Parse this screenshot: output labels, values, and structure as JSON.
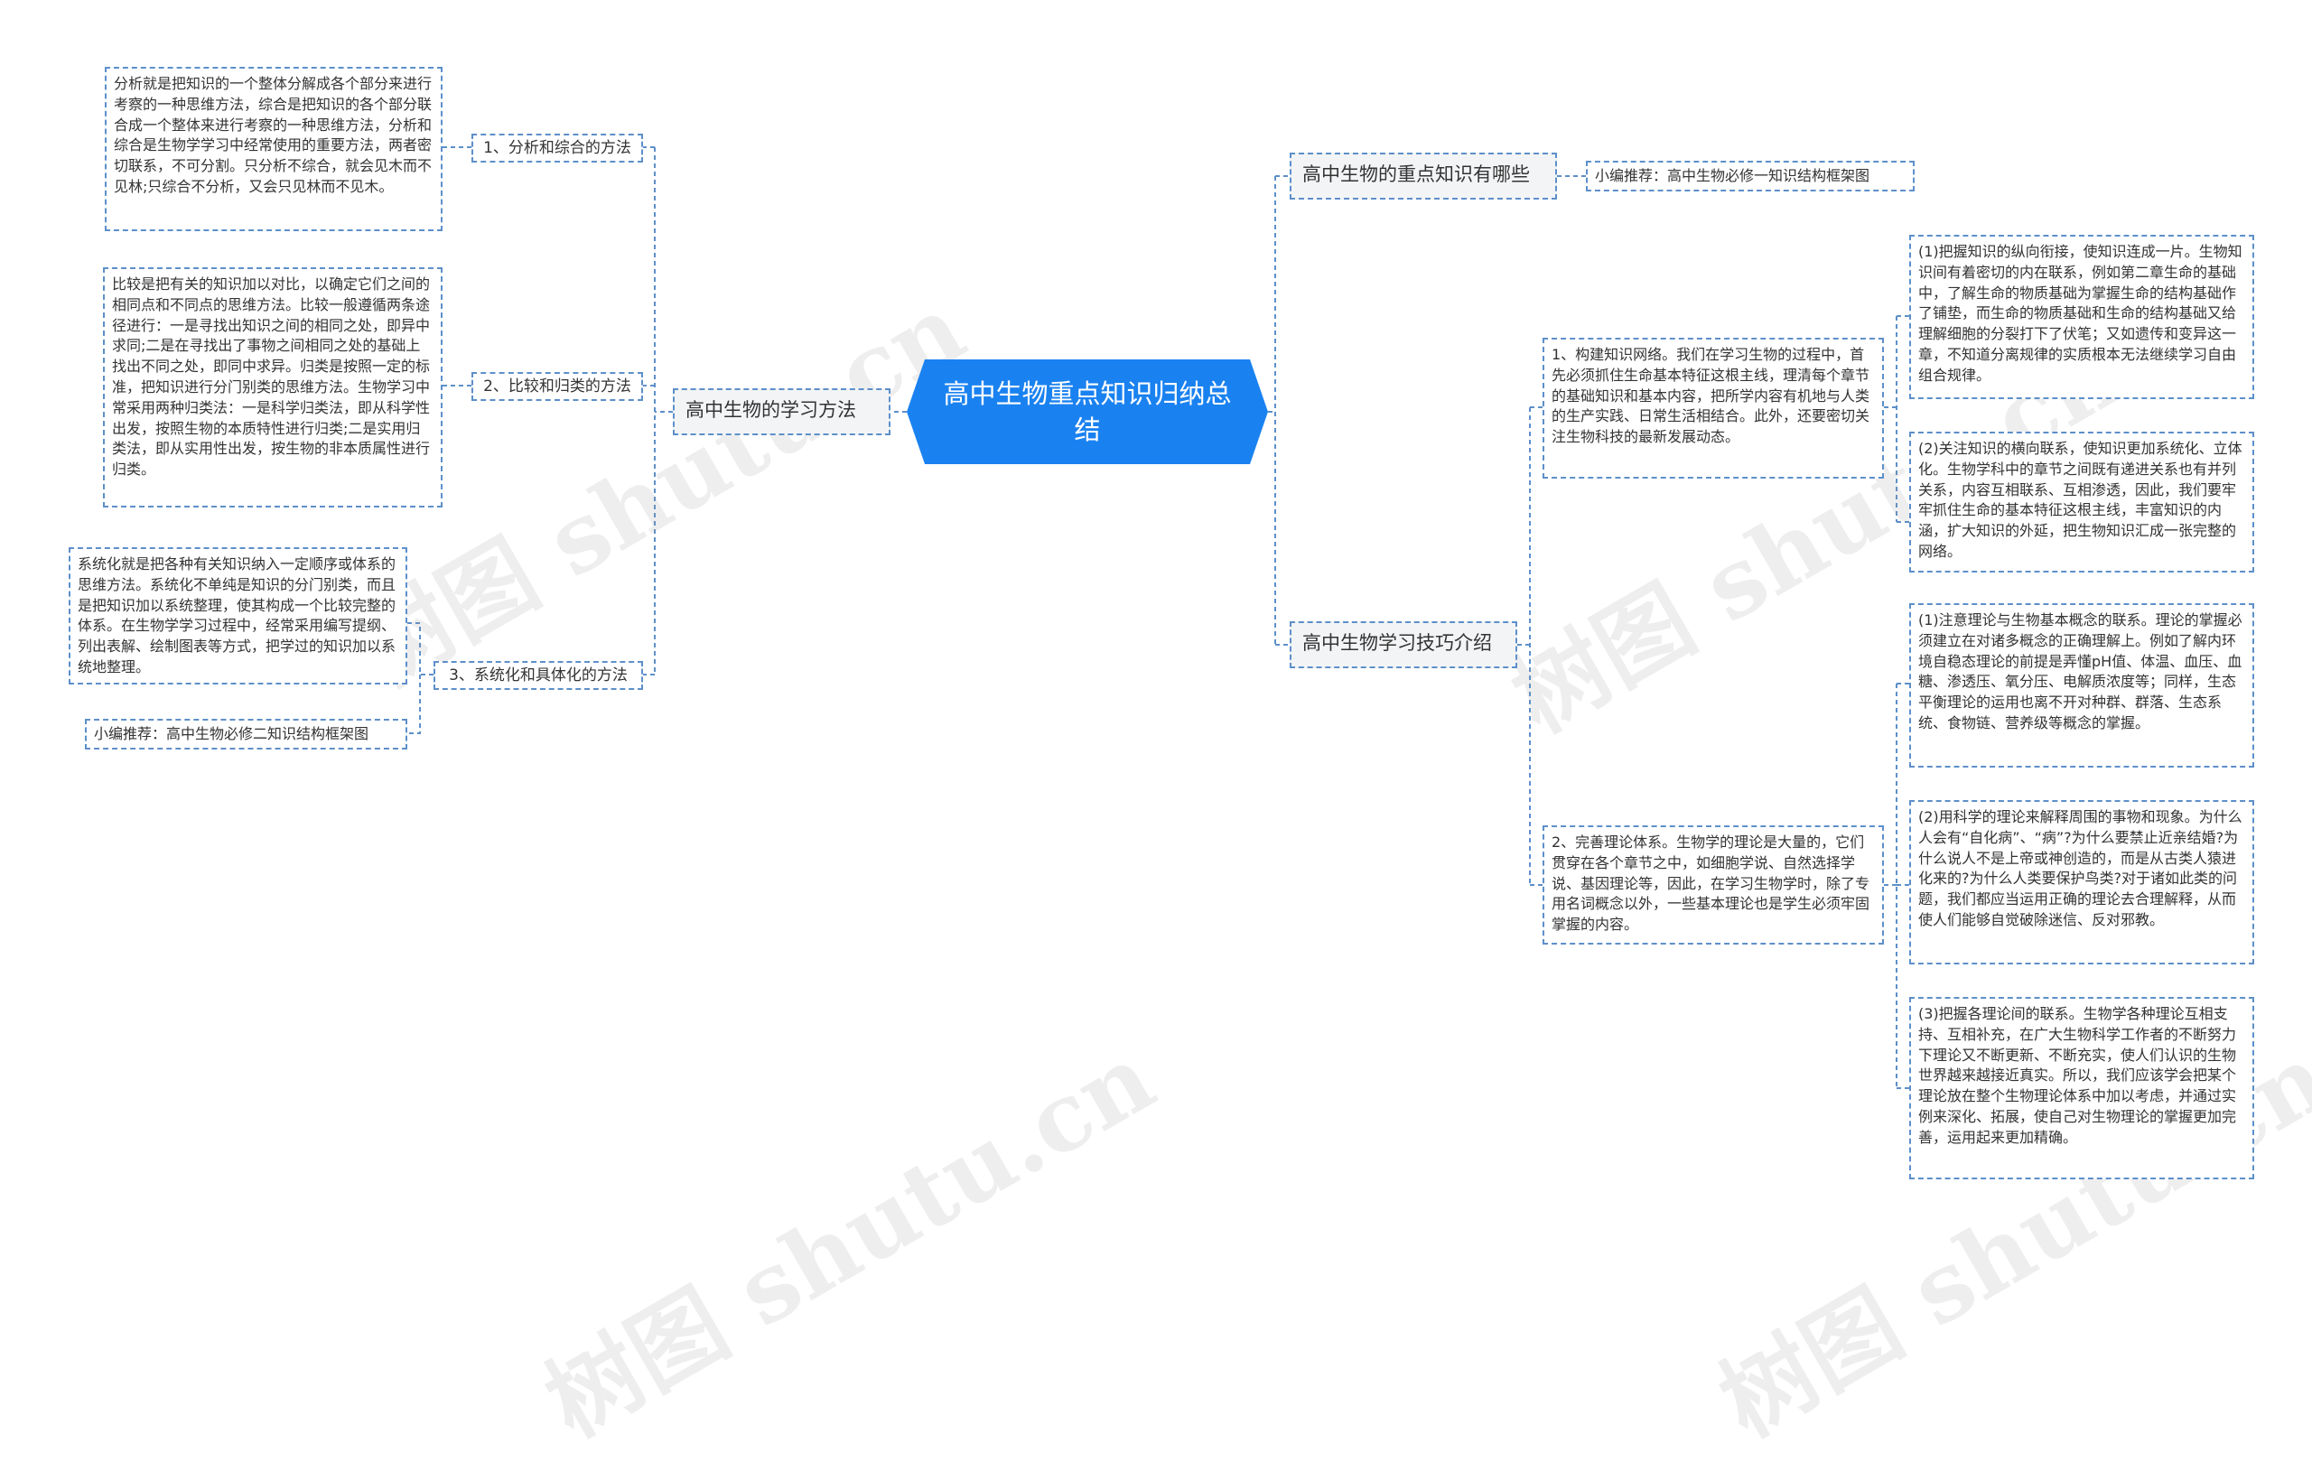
{
  "root": {
    "title": "高中生物重点知识归纳总结"
  },
  "watermark": "树图 shutu.cn",
  "left": {
    "branch": "高中生物的学习方法",
    "items": [
      {
        "label": "1、分析和综合的方法",
        "text": "分析就是把知识的一个整体分解成各个部分来进行考察的一种思维方法，综合是把知识的各个部分联合成一个整体来进行考察的一种思维方法，分析和综合是生物学学习中经常使用的重要方法，两者密切联系，不可分割。只分析不综合，就会见木而不见林;只综合不分析，又会只见林而不见木。"
      },
      {
        "label": "2、比较和归类的方法",
        "text": "比较是把有关的知识加以对比，以确定它们之间的相同点和不同点的思维方法。比较一般遵循两条途径进行：一是寻找出知识之间的相同之处，即异中求同;二是在寻找出了事物之间相同之处的基础上找出不同之处，即同中求异。归类是按照一定的标准，把知识进行分门别类的思维方法。生物学习中常采用两种归类法：一是科学归类法，即从科学性出发，按照生物的本质特性进行归类;二是实用归类法，即从实用性出发，按生物的非本质属性进行归类。"
      },
      {
        "label": "3、系统化和具体化的方法",
        "text": "系统化就是把各种有关知识纳入一定顺序或体系的思维方法。系统化不单纯是知识的分门别类，而且是把知识加以系统整理，使其构成一个比较完整的体系。在生物学学习过程中，经常采用编写提纲、列出表解、绘制图表等方式，把学过的知识加以系统地整理。",
        "reco": "小编推荐：高中生物必修二知识结构框架图"
      }
    ]
  },
  "right": {
    "branch1": {
      "label": "高中生物的重点知识有哪些",
      "reco": "小编推荐：高中生物必修一知识结构框架图"
    },
    "branch2": {
      "label": "高中生物学习技巧介绍",
      "items": [
        {
          "text": "1、构建知识网络。我们在学习生物的过程中，首先必须抓住生命基本特征这根主线，理清每个章节的基础知识和基本内容，把所学内容有机地与人类的生产实践、日常生活相结合。此外，还要密切关注生物科技的最新发展动态。",
          "children": [
            "(1)把握知识的纵向衔接，使知识连成一片。生物知识间有着密切的内在联系，例如第二章生命的基础中，了解生命的物质基础为掌握生命的结构基础作了铺垫，而生命的物质基础和生命的结构基础又给理解细胞的分裂打下了伏笔；又如遗传和变异这一章，不知道分离规律的实质根本无法继续学习自由组合规律。",
            "(2)关注知识的横向联系，使知识更加系统化、立体化。生物学科中的章节之间既有递进关系也有并列关系，内容互相联系、互相渗透，因此，我们要牢牢抓住生命的基本特征这根主线，丰富知识的内涵，扩大知识的外延，把生物知识汇成一张完整的网络。"
          ]
        },
        {
          "text": "2、完善理论体系。生物学的理论是大量的，它们贯穿在各个章节之中，如细胞学说、自然选择学说、基因理论等，因此，在学习生物学时，除了专用名词概念以外，一些基本理论也是学生必须牢固掌握的内容。",
          "children": [
            "(1)注意理论与生物基本概念的联系。理论的掌握必须建立在对诸多概念的正确理解上。例如了解内环境自稳态理论的前提是弄懂pH值、体温、血压、血糖、渗透压、氧分压、电解质浓度等；同样，生态平衡理论的运用也离不开对种群、群落、生态系统、食物链、营养级等概念的掌握。",
            "(2)用科学的理论来解释周围的事物和现象。为什么人会有“自化病”、“病”?为什么要禁止近亲结婚?为什么说人不是上帝或神创造的，而是从古类人猿进化来的?为什么人类要保护鸟类?对于诸如此类的问题，我们都应当运用正确的理论去合理解释，从而使人们能够自觉破除迷信、反对邪教。",
            "(3)把握各理论间的联系。生物学各种理论互相支持、互相补充，在广大生物科学工作者的不断努力下理论又不断更新、不断充实，使人们认识的生物世界越来越接近真实。所以，我们应该学会把某个理论放在整个生物理论体系中加以考虑，并通过实例来深化、拓展，使自己对生物理论的掌握更加完善，运用起来更加精确。"
          ]
        }
      ]
    }
  },
  "colors": {
    "root": "#1a82f0",
    "border": "#5d8fc9",
    "branch_bg": "#f2f4f6"
  }
}
